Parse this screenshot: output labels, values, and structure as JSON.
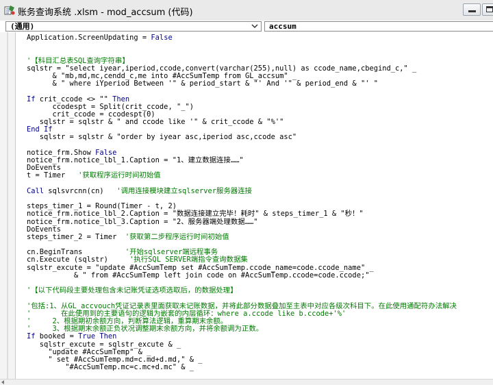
{
  "window": {
    "title": "账务查询系统 .xlsm - mod_accsum (代码)"
  },
  "toolbar": {
    "object_value": "(通用)",
    "procedure_value": "accsum"
  },
  "colors": {
    "keyword": "#00008b",
    "comment": "#007a00",
    "text": "#000000"
  },
  "code_lines": [
    [
      {
        "t": "Application.ScreenUpdating = "
      },
      {
        "t": "False",
        "c": "kw"
      }
    ],
    [],
    [],
    [
      {
        "t": "'【科目汇总表SQL查询字符串】",
        "c": "cm"
      }
    ],
    [
      {
        "t": "sqlstr = \"select iyear,iperiod,ccode,convert(varchar(255),null) as ccode_name,cbegind_c,\" _"
      }
    ],
    [
      {
        "t": "      & \"mb,md,mc,cendd_c,me into #AccSumTemp from GL_accsum\" _"
      }
    ],
    [
      {
        "t": "      & \" where iYperiod Between '\" & period_start & \"' And '\" & period_end & \"' \""
      }
    ],
    [],
    [
      {
        "t": "If ",
        "c": "kw"
      },
      {
        "t": "crit_ccode <> \"\" "
      },
      {
        "t": "Then",
        "c": "kw"
      }
    ],
    [
      {
        "t": "      ccodespt = Split(crit_ccode, \"_\")"
      }
    ],
    [
      {
        "t": "      crit_ccode = ccodespt(0)"
      }
    ],
    [
      {
        "t": "   sqlstr = sqlstr & \" and ccode like '\" & crit_ccode & \"%'\""
      }
    ],
    [
      {
        "t": "End If",
        "c": "kw"
      }
    ],
    [
      {
        "t": "   sqlstr = sqlstr & \"order by iyear asc,iperiod asc,ccode asc\""
      }
    ],
    [],
    [
      {
        "t": "notice_frm.Show "
      },
      {
        "t": "False",
        "c": "kw"
      }
    ],
    [
      {
        "t": "notice_frm.notice_lbl_1.Caption = \"1、建立数据连接……\""
      }
    ],
    [
      {
        "t": "DoEvents"
      }
    ],
    [
      {
        "t": "t = Timer   "
      },
      {
        "t": "'获取程序运行时间初始值",
        "c": "cm"
      }
    ],
    [],
    [
      {
        "t": "Call ",
        "c": "kw"
      },
      {
        "t": "sqlsvrcnn(cn)   "
      },
      {
        "t": "'调用连接模块建立sqlserver服务器连接",
        "c": "cm"
      }
    ],
    [],
    [
      {
        "t": "steps_timer_1 = Round(Timer - t, 2)"
      }
    ],
    [
      {
        "t": "notice_frm.notice_lbl_2.Caption = \"数据连接建立完毕！耗时\" & steps_timer_1 & \"秒！\""
      }
    ],
    [
      {
        "t": "notice_frm.notice_lbl_3.Caption = \"2、服务器端处理数据……\""
      }
    ],
    [
      {
        "t": "DoEvents"
      }
    ],
    [
      {
        "t": "steps_timer_2 = Timer  "
      },
      {
        "t": "'获取第二步程序运行时间初始值",
        "c": "cm"
      }
    ],
    [],
    [
      {
        "t": "cn.BeginTrans          "
      },
      {
        "t": "'开始sqlserver端远程事务",
        "c": "cm"
      }
    ],
    [
      {
        "t": "cn.Execute (sqlstr)     "
      },
      {
        "t": "'执行SQL SERVER端指令查询数据集",
        "c": "cm"
      }
    ],
    [
      {
        "t": "sqlstr_excute = \"update #AccSumTemp set #AccSumTemp.ccode_name=code.ccode_name\" _"
      }
    ],
    [
      {
        "t": "           & \" from #AccSumTemp left join code on #AccSumTemp.ccode=code.ccode;\""
      }
    ],
    [],
    [
      {
        "t": "'【以下代码段主要处理包含未记账凭证选项选取后，的数据处理】",
        "c": "cm"
      }
    ],
    [],
    [
      {
        "t": "'包括:1、从GL_accvouch凭证记录表里面获取未记账数据，并将此部分数据叠加至主表中对应各级次科目下。在此使用通配符办法解决",
        "c": "cm"
      }
    ],
    [
      {
        "t": "'       在此使用到的主要语句的逻辑为嵌套的内层循环：where a.ccode like b.ccode+'%'",
        "c": "cm"
      }
    ],
    [
      {
        "t": "'     2、根据期初余额方向，判断算法逻辑，重算期末余额。",
        "c": "cm"
      }
    ],
    [
      {
        "t": "'     3、根据期末余额正负状况调整期末余额方向，并将余额调为正数。",
        "c": "cm"
      }
    ],
    [
      {
        "t": "If ",
        "c": "kw"
      },
      {
        "t": "booked = "
      },
      {
        "t": "True Then",
        "c": "kw"
      }
    ],
    [
      {
        "t": "   sqlstr_excute = sqlstr_excute & _"
      }
    ],
    [
      {
        "t": "     \"update #AccSumTemp\" & _"
      }
    ],
    [
      {
        "t": "     \" set #AccSumTemp.md=c.md+d.md,\" & _"
      }
    ],
    [
      {
        "t": "         \"#AccSumTemp.mc=c.mc+d.mc\" & _"
      }
    ]
  ]
}
